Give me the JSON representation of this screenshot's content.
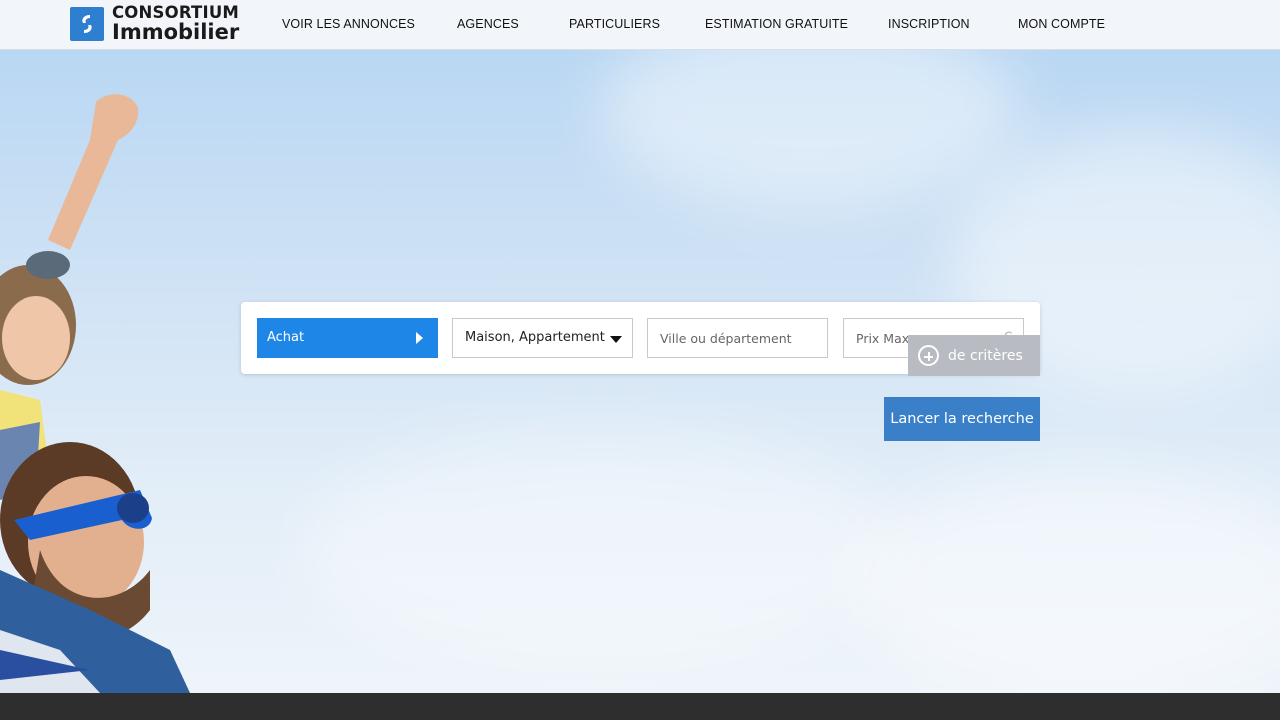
{
  "brand": {
    "line1": "CONSORTIUM",
    "line2": "Immobilier",
    "accent": "#2f7fd0"
  },
  "nav": {
    "items": [
      {
        "label": "VOIR LES ANNONCES"
      },
      {
        "label": "AGENCES"
      },
      {
        "label": "PARTICULIERS"
      },
      {
        "label": "ESTIMATION GRATUITE"
      },
      {
        "label": "INSCRIPTION"
      },
      {
        "label": "MON COMPTE"
      }
    ]
  },
  "search": {
    "transaction": "Achat",
    "property_type": "Maison, Appartement",
    "city_placeholder": "Ville ou département",
    "price_placeholder": "Prix Max",
    "currency": "€",
    "criteria_label": "de critères",
    "submit_label": "Lancer la recherche"
  },
  "colors": {
    "primary_blue": "#1e86e6",
    "submit_blue": "#3a80c9",
    "criteria_gray": "#b8bcc2",
    "footer_dark": "#2e2e2e"
  },
  "icons": {
    "criteria": "plus-circle-icon",
    "dropdown": "caret-down-icon",
    "transaction": "triangle-right-icon"
  }
}
